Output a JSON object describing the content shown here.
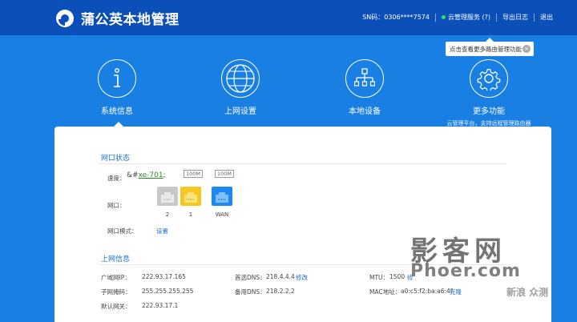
{
  "header": {
    "title": "蒲公英本地管理",
    "sn_label": "SN码：0306****7574",
    "cloud_service": "云管理服务 (?)",
    "export_log": "导出日志",
    "logout": "退出"
  },
  "tooltip": {
    "text": "点击查看更多路由管理功能",
    "close": "×"
  },
  "nav": [
    {
      "label": "系统信息",
      "icon": "info-icon"
    },
    {
      "label": "上网设置",
      "icon": "globe-icon"
    },
    {
      "label": "本地设备",
      "icon": "network-tree-icon"
    },
    {
      "label": "更多功能",
      "sub": "云管理平台，支持远程管理路由器",
      "icon": "gear-icon"
    }
  ],
  "port_status": {
    "title": "网口状态",
    "speed_label": "速度：",
    "speed_value_prefix": "&#",
    "speed_value_link": "xe-701",
    "speed_value_suffix": ";",
    "speed_boxes": [
      "100M",
      "100M"
    ],
    "port_label": "网口：",
    "ports": [
      {
        "name": "2",
        "color": "#c8c8c8"
      },
      {
        "name": "1",
        "color": "#f5c820"
      },
      {
        "name": "WAN",
        "color": "#1e88f0"
      }
    ],
    "mode_label": "网口模式：",
    "mode_link": "设置"
  },
  "net_info": {
    "title": "上网信息",
    "wan_ip_label": "广域网IP：",
    "wan_ip": "222.93.17.165",
    "mask_label": "子网掩码：",
    "mask": "255.255.255.255",
    "gateway_label": "默认网关：",
    "gateway": "222.93.17.1",
    "dns1_label": "首选DNS：",
    "dns1": "218.4.4.4",
    "dns_edit": "修改",
    "dns2_label": "备用DNS：",
    "dns2": "218.2.2.2",
    "mtu_label": "MTU：",
    "mtu": "1500",
    "mtu_edit": "修",
    "mac_label": "MAC地址：",
    "mac": "a0:c5:f2:ba:a6:4f",
    "mac_clone": "克隆"
  },
  "watermark": {
    "line1": "影客网",
    "line2": "Phoer.com",
    "line3": "新浪 众测"
  },
  "colors": {
    "header_bg": "#0b4fb8",
    "body_bg": "#1a7fe3",
    "accent": "#1a6fd4"
  }
}
